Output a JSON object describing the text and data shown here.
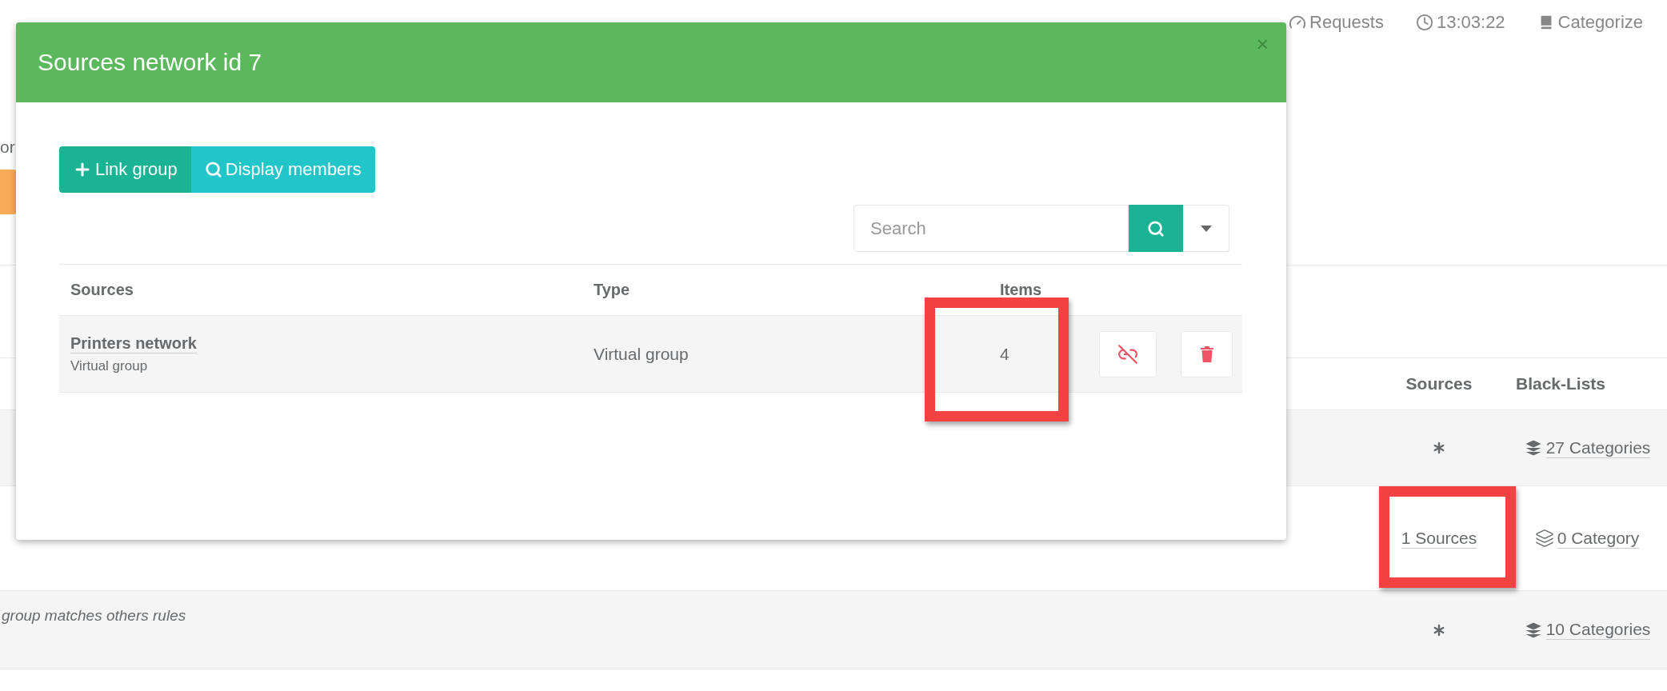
{
  "top_bar": {
    "items": [
      {
        "kind": "requests",
        "label": "Requests"
      },
      {
        "kind": "clock",
        "label": "13:03:22"
      },
      {
        "kind": "book",
        "label": "Categorize"
      }
    ]
  },
  "background": {
    "left_text": "or",
    "table": {
      "columns": [
        "Sources",
        "Black-Lists"
      ],
      "rows": [
        {
          "description": "",
          "sources": {
            "kind": "any",
            "highlighted": false
          },
          "blacklist": {
            "kind": "solid",
            "label": "27 Categories"
          }
        },
        {
          "description": "",
          "sources": {
            "kind": "link",
            "label": "1 Sources",
            "highlighted": true
          },
          "blacklist": {
            "kind": "outline",
            "label": "0 Category"
          }
        },
        {
          "description": "group matches others rules",
          "sources": {
            "kind": "any",
            "highlighted": false
          },
          "blacklist": {
            "kind": "solid",
            "label": "10 Categories"
          }
        }
      ]
    }
  },
  "modal": {
    "title": "Sources network id 7",
    "close": "×",
    "buttons": [
      {
        "kind": "add",
        "label": "Link group"
      },
      {
        "kind": "search",
        "label": "Display members"
      }
    ],
    "search": {
      "placeholder": "Search"
    },
    "table": {
      "columns": [
        "Sources",
        "Type",
        "Items"
      ],
      "rows": [
        {
          "name": "Printers network",
          "subtitle": "Virtual group",
          "type": "Virtual group",
          "items": "4",
          "highlighted": true
        }
      ]
    }
  }
}
